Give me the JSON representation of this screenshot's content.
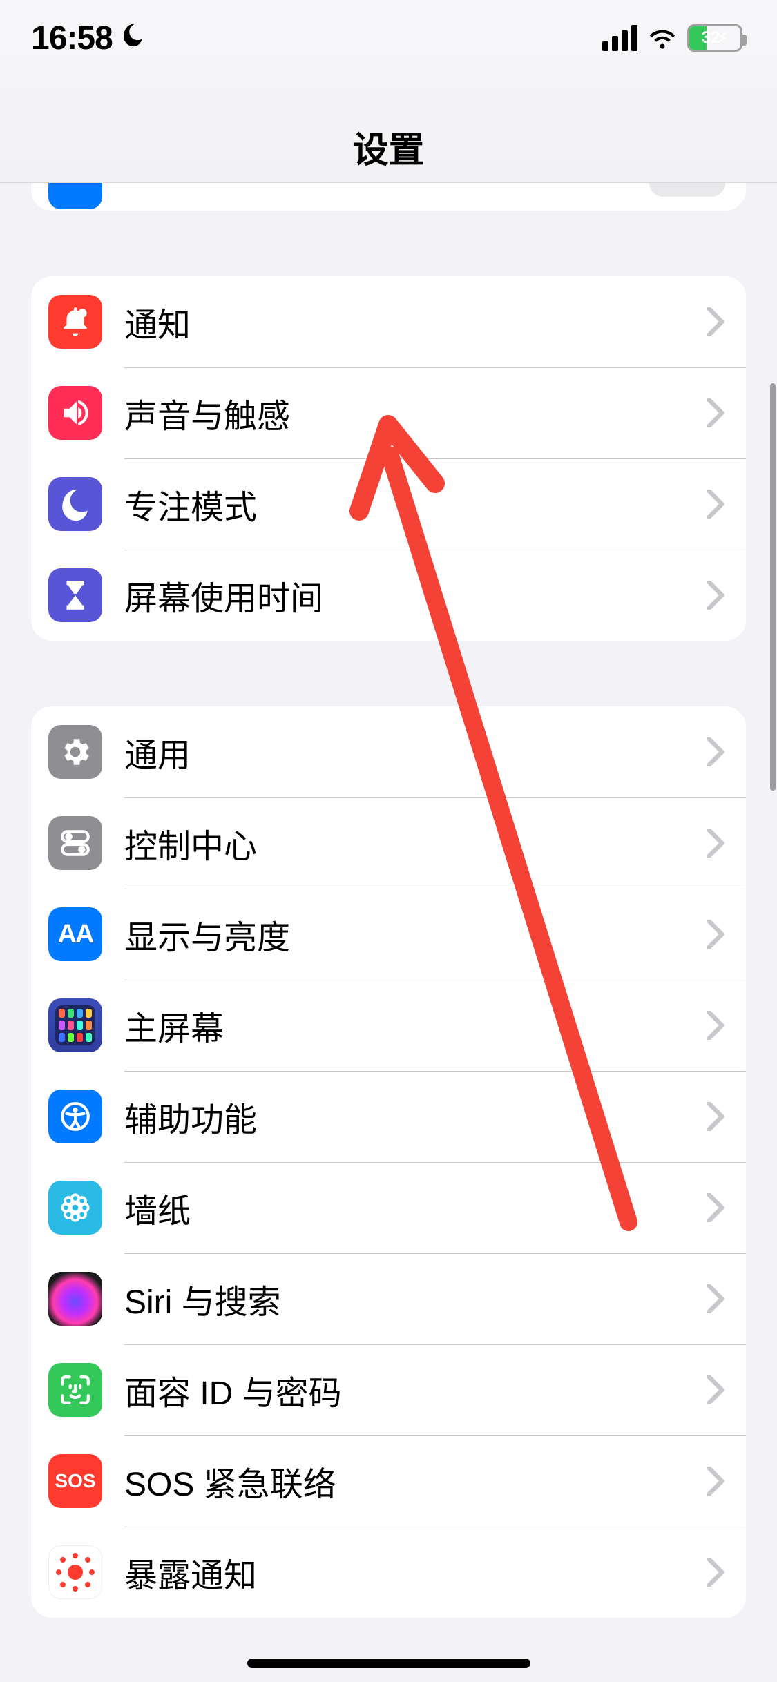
{
  "status": {
    "time": "16:58",
    "battery_percent": "32",
    "battery_charging_glyph": "⚡︎"
  },
  "header": {
    "title": "设置"
  },
  "groups": [
    {
      "rows": [
        {
          "icon": "notifications-icon",
          "label": "通知"
        },
        {
          "icon": "sounds-icon",
          "label": "声音与触感"
        },
        {
          "icon": "focus-icon",
          "label": "专注模式"
        },
        {
          "icon": "screentime-icon",
          "label": "屏幕使用时间"
        }
      ]
    },
    {
      "rows": [
        {
          "icon": "general-icon",
          "label": "通用"
        },
        {
          "icon": "control-center-icon",
          "label": "控制中心"
        },
        {
          "icon": "display-icon",
          "label": "显示与亮度",
          "badge": "AA"
        },
        {
          "icon": "home-screen-icon",
          "label": "主屏幕"
        },
        {
          "icon": "accessibility-icon",
          "label": "辅助功能"
        },
        {
          "icon": "wallpaper-icon",
          "label": "墙纸"
        },
        {
          "icon": "siri-icon",
          "label": "Siri 与搜索"
        },
        {
          "icon": "faceid-icon",
          "label": "面容 ID 与密码"
        },
        {
          "icon": "sos-icon",
          "label": "SOS 紧急联络",
          "badge": "SOS"
        },
        {
          "icon": "exposure-icon",
          "label": "暴露通知"
        }
      ]
    }
  ]
}
